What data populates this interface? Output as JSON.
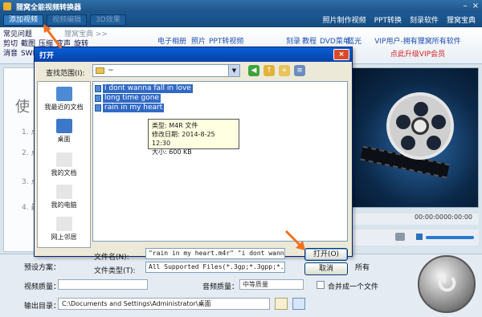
{
  "app": {
    "title": "狸窝全能视频转换器",
    "win_min": "–",
    "win_close": "×"
  },
  "menubar": {
    "add_video": "添加视频",
    "edit_video": "视频编辑",
    "effect_3d": "3D效果",
    "links": [
      "照片制作视频",
      "PPT转换",
      "刻录软件",
      "狸窝宝典"
    ]
  },
  "toolbar": {
    "faq": "常见问题",
    "baodian": "狸窝宝典 >>",
    "row2": [
      "剪切",
      "截图",
      "压缩",
      "变声",
      "旋转"
    ],
    "row3": [
      "消音",
      "SWF"
    ],
    "items": [
      "电子相册",
      "照片",
      "PPT转视频",
      "刻录",
      "教程",
      "DVD菜单",
      "蓝光"
    ],
    "vip_line1": "VIP用户-拥有狸窝所有软件",
    "vip_line2": "点此升级VIP会员"
  },
  "leftpane": {
    "big_text": "使",
    "points": [
      "1. 点",
      "2. 点",
      "3. 点",
      "4. 最"
    ]
  },
  "preview": {
    "time_left": "00:00:00",
    "time_right": "00:00:00"
  },
  "bottom": {
    "preset_label": "预设方案：",
    "video_quality_label": "视频质量：",
    "audio_quality_label": "音频质量：",
    "audio_quality_value": "中等质量",
    "apply_all": "所有",
    "merge_label": "合并成一个文件",
    "output_label": "输出目录：",
    "output_path": "C:\\Documents and Settings\\Administrator\\桌面"
  },
  "dialog": {
    "title": "打开",
    "close": "×",
    "lookin_label": "查找范围(I):",
    "lookin_value": "~",
    "places": [
      "我最近的文档",
      "桌面",
      "我的文档",
      "我的电脑",
      "网上邻居"
    ],
    "files": [
      "i dont wanna fall in love",
      "long time gone",
      "rain in my heart"
    ],
    "tooltip": {
      "type": "类型: M4R 文件",
      "modified": "修改日期: 2014-8-25 12:30",
      "size": "大小: 600 KB"
    },
    "filename_label": "文件名(N):",
    "filename_value": "\"rain in my heart.m4r\" \"i dont wanna :",
    "filetype_label": "文件类型(T):",
    "filetype_value": "All Supported Files(*.3gp;*.3gpp;*.3g",
    "open_button": "打开(O)",
    "cancel_button": "取消"
  },
  "colors": {
    "title_bar": "#1d5388",
    "selection": "#316ac5",
    "arrow": "#f07020",
    "vip_red": "#d12020"
  }
}
